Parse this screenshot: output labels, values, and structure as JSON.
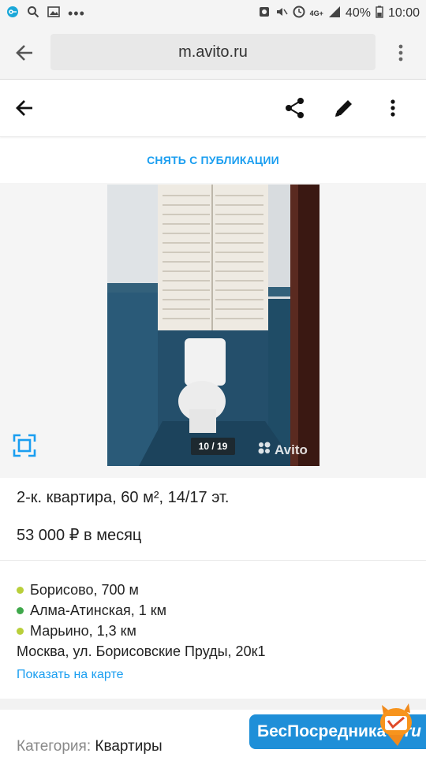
{
  "status_bar": {
    "network": "4G+",
    "battery": "40%",
    "time": "10:00"
  },
  "browser": {
    "url": "m.avito.ru"
  },
  "toolbar": {
    "unpublish_label": "СНЯТЬ С ПУБЛИКАЦИИ"
  },
  "gallery": {
    "counter": "10 / 19",
    "watermark": "Avito"
  },
  "listing": {
    "title": "2-к. квартира, 60 м², 14/17 эт.",
    "price": "53 000 ₽ в месяц",
    "metro": [
      {
        "name": "Борисово, 700 м",
        "color": "#b9cf3a"
      },
      {
        "name": "Алма-Атинская, 1 км",
        "color": "#3fa84b"
      },
      {
        "name": "Марьино, 1,3 км",
        "color": "#b9cf3a"
      }
    ],
    "address": "Москва, ул. Борисовские Пруды, 20к1",
    "map_link": "Показать на карте",
    "category_key": "Категория:",
    "category_value": "Квартиры"
  },
  "badge": {
    "text": "БесПосредника",
    "suffix": ".ru"
  },
  "colors": {
    "accent": "#1a9ef0"
  }
}
